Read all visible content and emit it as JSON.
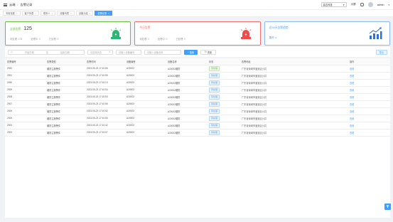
{
  "topbar": {
    "breadcrumb": [
      "云端",
      "告警记录"
    ],
    "region": "高达科技",
    "size_label": "大屏",
    "user": "admin"
  },
  "tabs": [
    {
      "label": "专用变更",
      "active": false
    },
    {
      "label": "客户列表",
      "active": false
    },
    {
      "label": "联系人",
      "active": false
    },
    {
      "label": "设备列表",
      "active": false
    },
    {
      "label": "设备分组",
      "active": false
    },
    {
      "label": "告警记录",
      "active": true
    }
  ],
  "cards": {
    "all": {
      "title": "全部告警",
      "count": "125",
      "pending": "待处理: 175",
      "processing": "处理中: 0",
      "done": "已处理: 0"
    },
    "today": {
      "title": "今日告警",
      "pending": "待处理: 0",
      "processing": "处理中: 0",
      "done": "已处理: 0"
    },
    "stats": {
      "title": "近30天告警趋势",
      "link": "展开 ∨"
    }
  },
  "filter": {
    "start_placeholder": "开始日期",
    "end_placeholder": "结束日期",
    "status_placeholder": "请选择状态",
    "device_no_placeholder": "请输入设备编号",
    "device_name_placeholder": "请输入设备名称",
    "search_label": "搜索",
    "reset_label": "重置",
    "export_label": "导出"
  },
  "table": {
    "headers": [
      "告警编号",
      "告警类型",
      "告警时间",
      "设备编号",
      "设备名称",
      "状态",
      "告警地址",
      "操作"
    ],
    "rows": [
      [
        "2932",
        "烟雾主报警件",
        "2023-05-23 17:10:56",
        "A20002",
        "A20002烟雾",
        "待处理",
        "广东省深圳市宝安区沙井",
        "查看"
      ],
      [
        "2931",
        "烟雾主报警件",
        "2023-05-23 17:10:55",
        "A20002",
        "A20002烟雾",
        "待处理",
        "广东省深圳市宝安区沙井",
        "查看"
      ],
      [
        "2930",
        "烟雾主报警件",
        "2023-05-23 17:10:13",
        "A20002",
        "A20002烟雾",
        "待处理",
        "广东省深圳市宝安区沙井",
        "查看"
      ],
      [
        "2929",
        "烟雾主报警件",
        "2023-05-23 17:10:54",
        "A20002",
        "A20002烟雾",
        "待处理",
        "广东省深圳市宝安区沙井",
        "查看"
      ],
      [
        "2928",
        "烟雾主报警件",
        "2023-05-23 17:10:53",
        "A20002",
        "A20002烟雾",
        "待处理",
        "广东省深圳市宝安区沙井",
        "查看"
      ],
      [
        "2927",
        "烟雾主报警件",
        "2023-05-23 17:10:56",
        "A20002",
        "A20002烟雾",
        "待处理",
        "广东省深圳市宝安区沙井",
        "查看"
      ],
      [
        "2926",
        "烟雾主报警件",
        "2023-05-23 17:10:52",
        "A20002",
        "A20002烟雾",
        "待处理",
        "广东省深圳市宝安区沙井",
        "查看"
      ],
      [
        "2925",
        "烟雾主报警件",
        "2023-05-23 17:10:50",
        "A20002",
        "A20002烟雾",
        "待处理",
        "广东省深圳市宝安区沙井",
        "查看"
      ],
      [
        "2924",
        "烟雾主报警件",
        "2023-05-23 17:10:42",
        "A20002",
        "A20002烟雾",
        "待处理",
        "广东省深圳市宝安区沙井",
        "查看"
      ],
      [
        "2923",
        "烟雾主报警件",
        "2023-05-23 17:10:57",
        "A20002",
        "A20002烟雾",
        "待处理",
        "广东省深圳市宝安区沙井",
        "查看"
      ]
    ]
  },
  "colors": {
    "primary": "#409eff",
    "success": "#67c23a",
    "danger": "#f56c6c"
  }
}
